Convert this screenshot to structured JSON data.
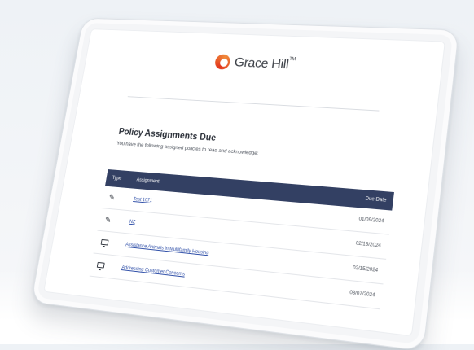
{
  "brand": {
    "name": "Grace Hill",
    "mark": "TM"
  },
  "page": {
    "title": "Policy Assignments Due",
    "subtitle": "You have the following assigned policies to read and acknowledge:"
  },
  "table": {
    "headers": {
      "type": "Type",
      "assignment": "Assignment",
      "due": "Due Date"
    },
    "rows": [
      {
        "icon": "document-sign-icon",
        "assignment": "Test 1071",
        "due": "01/09/2024"
      },
      {
        "icon": "document-sign-icon",
        "assignment": "NZ",
        "due": "02/13/2024"
      },
      {
        "icon": "monitor-icon",
        "assignment": "Assistance Animals in Multifamily Housing",
        "due": "02/15/2024"
      },
      {
        "icon": "monitor-icon",
        "assignment": "Addressing Customer Concerns",
        "due": "03/07/2024"
      }
    ]
  }
}
